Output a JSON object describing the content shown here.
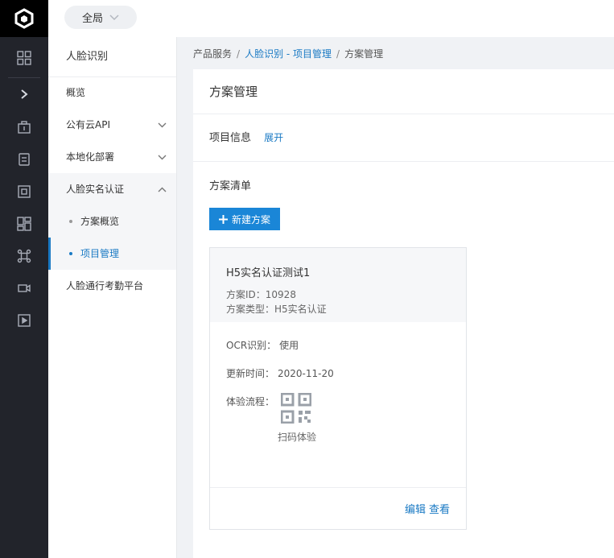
{
  "topbar": {
    "scope_label": "全局"
  },
  "subnav": {
    "title": "人脸识别",
    "items": [
      {
        "label": "概览"
      },
      {
        "label": "公有云API"
      },
      {
        "label": "本地化部署"
      },
      {
        "label": "人脸实名认证"
      }
    ],
    "sub_items": [
      {
        "label": "方案概览"
      },
      {
        "label": "项目管理"
      }
    ],
    "last_item": {
      "label": "人脸通行考勤平台"
    }
  },
  "breadcrumb": {
    "root": "产品服务",
    "middle": "人脸识别 - 项目管理",
    "current": "方案管理",
    "separator": "/"
  },
  "panel": {
    "title": "方案管理",
    "project_info_label": "项目信息",
    "expand_label": "展开",
    "list_title": "方案清单",
    "new_button_label": "新建方案"
  },
  "card": {
    "name": "H5实名认证测试1",
    "id_line": "方案ID：10928",
    "type_line": "方案类型：H5实名认证",
    "ocr_label": "OCR识别：",
    "ocr_value": "使用",
    "updated_label": "更新时间：",
    "updated_value": "2020-11-20",
    "flow_label": "体验流程：",
    "qr_label": "扫码体验",
    "edit_label": "编辑",
    "view_label": "查看"
  },
  "colors": {
    "accent": "#1a7ac4",
    "button": "#1a86d7",
    "rail": "#22242b"
  }
}
